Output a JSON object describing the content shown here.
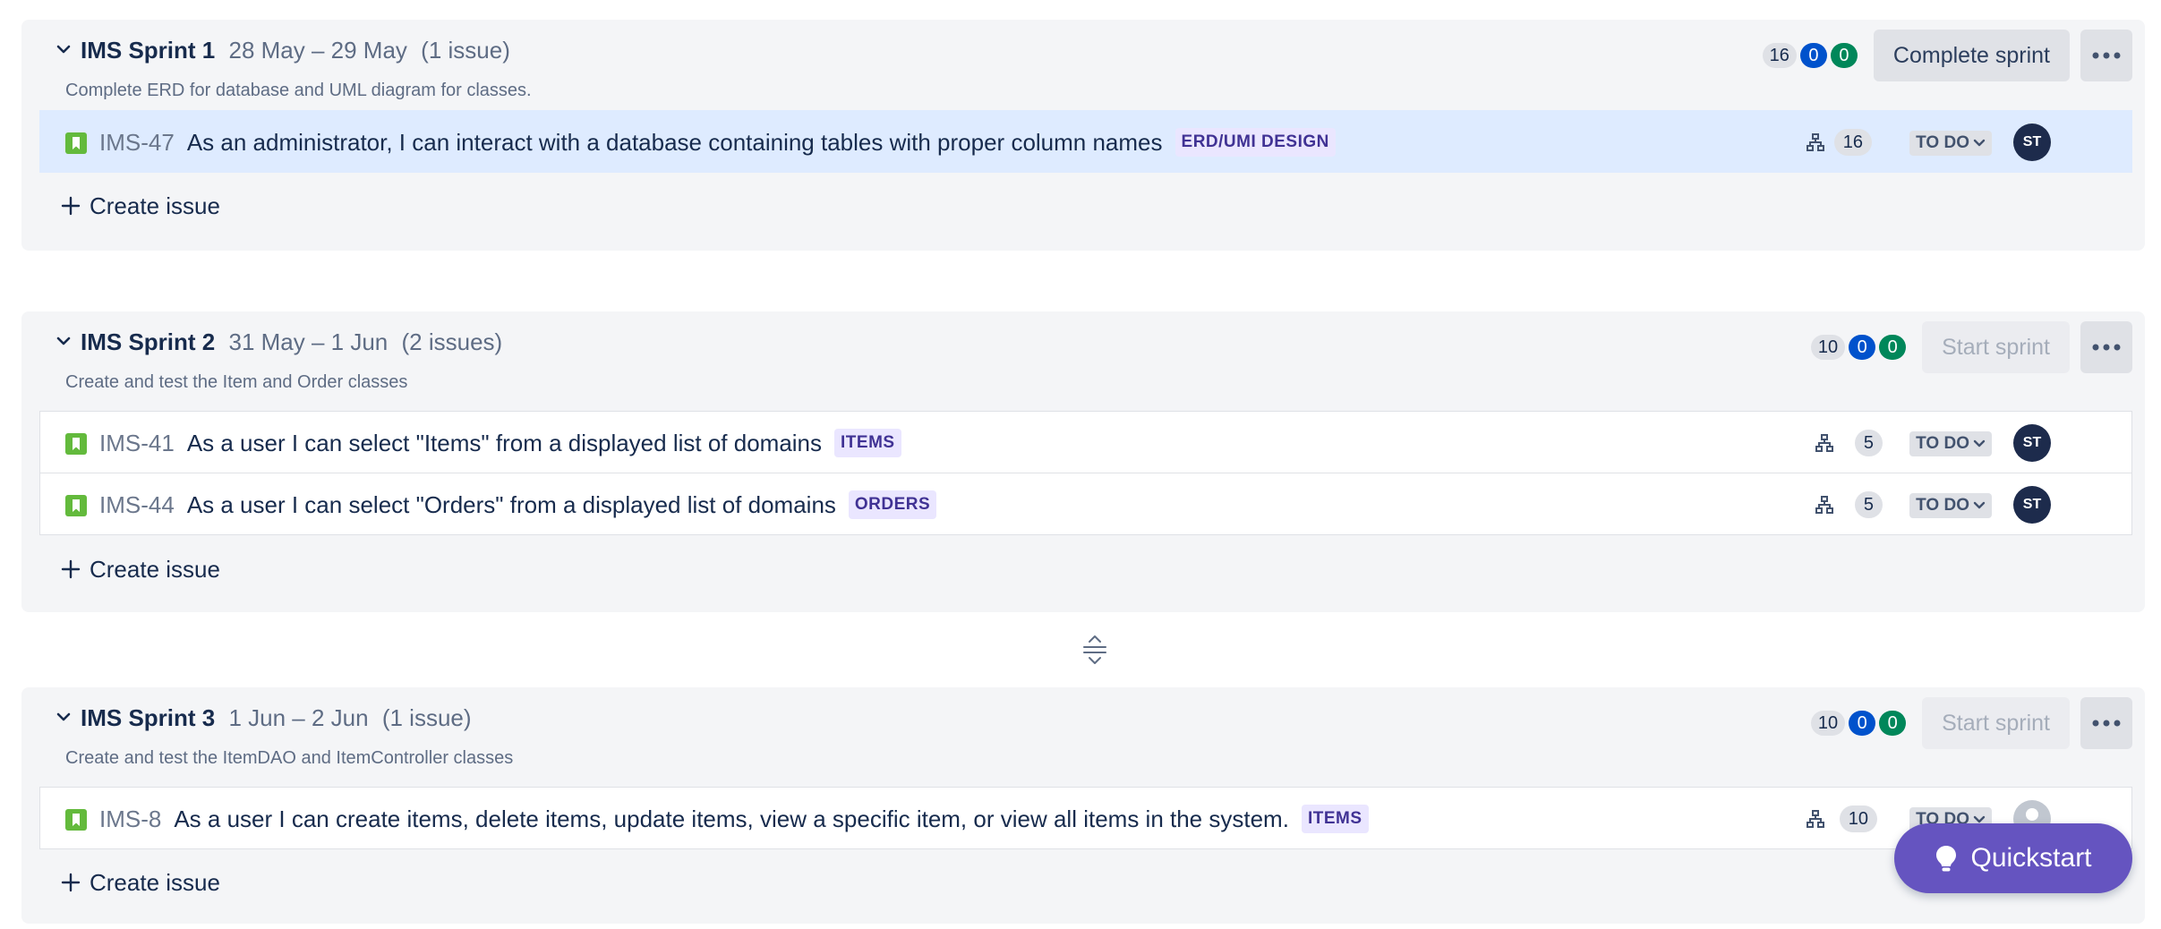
{
  "sprints": [
    {
      "name": "IMS Sprint 1",
      "dates": "28 May – 29 May",
      "count": "(1 issue)",
      "goal": "Complete ERD for database and UML diagram for classes.",
      "points_todo": "16",
      "points_inprogress": "0",
      "points_done": "0",
      "action": "Complete sprint",
      "action_enabled": true,
      "create_label": "Create issue",
      "issues": [
        {
          "key": "IMS-47",
          "summary": "As an administrator, I can interact with a database containing tables with proper column names",
          "epic": "ERD/UMI DESIGN",
          "points": "16",
          "status": "TO DO",
          "assignee": "ST",
          "selected": true
        }
      ]
    },
    {
      "name": "IMS Sprint 2",
      "dates": "31 May – 1 Jun",
      "count": "(2 issues)",
      "goal": "Create and test the Item and Order classes",
      "points_todo": "10",
      "points_inprogress": "0",
      "points_done": "0",
      "action": "Start sprint",
      "action_enabled": false,
      "create_label": "Create issue",
      "issues": [
        {
          "key": "IMS-41",
          "summary": "As a user I can select \"Items\" from a displayed list of domains",
          "epic": "ITEMS",
          "points": "5",
          "status": "TO DO",
          "assignee": "ST"
        },
        {
          "key": "IMS-44",
          "summary": "As a user I can select \"Orders\" from a displayed list of domains",
          "epic": "ORDERS",
          "points": "5",
          "status": "TO DO",
          "assignee": "ST"
        }
      ]
    },
    {
      "name": "IMS Sprint 3",
      "dates": "1 Jun – 2 Jun",
      "count": "(1 issue)",
      "goal": "Create and test the ItemDAO and ItemController classes",
      "points_todo": "10",
      "points_inprogress": "0",
      "points_done": "0",
      "action": "Start sprint",
      "action_enabled": false,
      "create_label": "Create issue",
      "issues": [
        {
          "key": "IMS-8",
          "summary": "As a user I can create items, delete items, update items, view a specific item, or view all items in the system.",
          "epic": "ITEMS",
          "points": "10",
          "status": "TO DO",
          "assignee": ""
        }
      ]
    }
  ],
  "quickstart_label": "Quickstart",
  "colors": {
    "story_icon": "#63ba3c",
    "epic_bg": "#eae6ff",
    "epic_text": "#403294",
    "selected_row": "#deebff",
    "todo_pill": "#dfe1e6",
    "inprogress_pill": "#0052cc",
    "done_pill": "#00875a",
    "quickstart": "#6554c0"
  },
  "icons": {
    "collapse": "chevron-down-icon",
    "issue_type": "story-icon",
    "child_issues": "child-issues-icon",
    "status_dropdown": "chevron-down-icon",
    "more": "more-icon",
    "create": "plus-icon",
    "divider": "drag-handle-icon",
    "quickstart": "lightbulb-icon",
    "unassigned": "unassigned-avatar-icon"
  }
}
